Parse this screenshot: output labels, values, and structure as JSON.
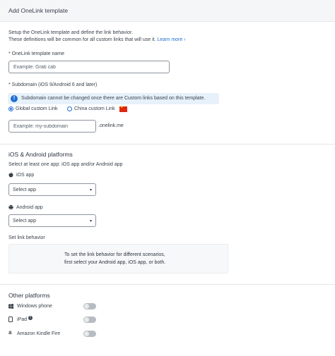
{
  "header": {
    "title": "Add OneLink template"
  },
  "intro": {
    "line1": "Setup the OneLink template and define the link behavior.",
    "line2": "These definitions will be common for all custom links that will use it.",
    "learn_more": "Learn more ›"
  },
  "template_name": {
    "label": "* OneLink template name",
    "placeholder": "Example: Grab cab"
  },
  "subdomain": {
    "label": "* Subdomain (iOS 9/Android 6 and later)",
    "info": "Subdomain cannot be changed once there are Custom links based on this template.",
    "radio_global": "Global custom Link",
    "radio_china": "China custom Link",
    "selected": "global",
    "placeholder": "Example: my-subdomain",
    "suffix": ".onelink.me"
  },
  "platforms": {
    "title": "iOS & Android platforms",
    "hint": "Select at least one app: iOS app and/or Android app",
    "ios_label": "iOS app",
    "ios_select": "Select app",
    "android_label": "Android app",
    "android_select": "Select app"
  },
  "link_behavior": {
    "title": "Set link behavior",
    "line1": "To set the link behavior for different scenarios,",
    "line2": "first select your Android app, iOS app, or both."
  },
  "other_platforms": {
    "title": "Other platforms",
    "items": [
      {
        "label": "Windows phone",
        "icon": "windows-icon",
        "enabled": false
      },
      {
        "label": "iPad",
        "icon": "tablet-icon",
        "enabled": false
      },
      {
        "label": "Amazon Kindle Fire",
        "icon": "amazon-icon",
        "enabled": false
      }
    ]
  },
  "colors": {
    "accent": "#1f6fd1",
    "info_bg": "#e6f1fb",
    "flag_red": "#de2910"
  }
}
